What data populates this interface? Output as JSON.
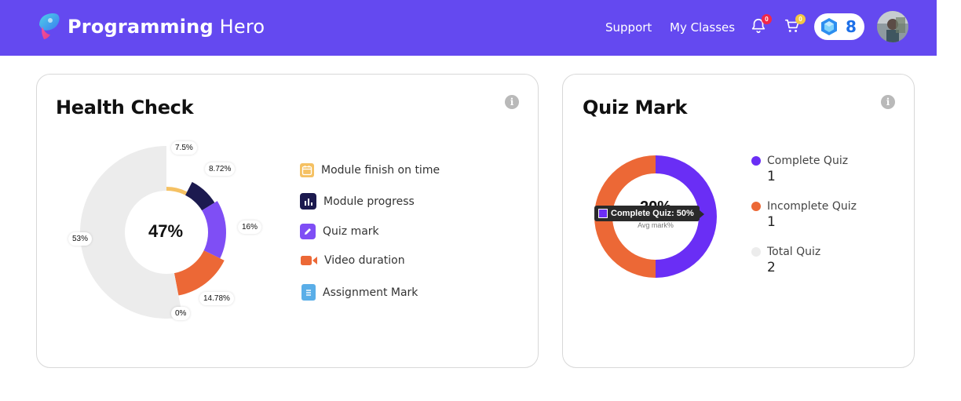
{
  "brand": {
    "name_bold": "Programming",
    "name_light": " Hero"
  },
  "nav": {
    "support": "Support",
    "my_classes": "My Classes",
    "notification_count": "0",
    "cart_count": "0",
    "gems": "8"
  },
  "health_check": {
    "title": "Health Check",
    "center_value": "47%",
    "slice_labels": [
      "7.5%",
      "8.72%",
      "16%",
      "14.78%",
      "0%",
      "53%"
    ],
    "legend": [
      {
        "label": "Module finish on time",
        "icon": "calendar-icon",
        "color": "#f5c163"
      },
      {
        "label": "Module progress",
        "icon": "bar-chart-icon",
        "color": "#1c1a4f"
      },
      {
        "label": "Quiz mark",
        "icon": "pencil-icon",
        "color": "#7f4ef5"
      },
      {
        "label": "Video duration",
        "icon": "video-camera-icon",
        "color": "#ec6836"
      },
      {
        "label": "Assignment Mark",
        "icon": "document-icon",
        "color": "#5aaee8"
      }
    ],
    "remaining_color": "#ececec"
  },
  "quiz_mark": {
    "title": "Quiz Mark",
    "center_value": "20%",
    "center_sublabel": "Avg mark%",
    "tooltip": "Complete Quiz: 50%",
    "items": [
      {
        "label": "Complete Quiz",
        "value": "1",
        "color": "#6a2ef5"
      },
      {
        "label": "Incomplete Quiz",
        "value": "1",
        "color": "#ec6836"
      },
      {
        "label": "Total Quiz",
        "value": "2",
        "color": "#ececec"
      }
    ]
  },
  "chart_data": [
    {
      "type": "pie",
      "title": "Health Check",
      "categories": [
        "Module finish on time",
        "Module progress",
        "Quiz mark",
        "Video duration",
        "Assignment Mark",
        "Remaining"
      ],
      "values": [
        7.5,
        8.72,
        16,
        14.78,
        0,
        53
      ],
      "center_label": "47%"
    },
    {
      "type": "pie",
      "title": "Quiz Mark",
      "categories": [
        "Complete Quiz",
        "Incomplete Quiz"
      ],
      "values": [
        50,
        50
      ],
      "center_label": "20%"
    }
  ]
}
